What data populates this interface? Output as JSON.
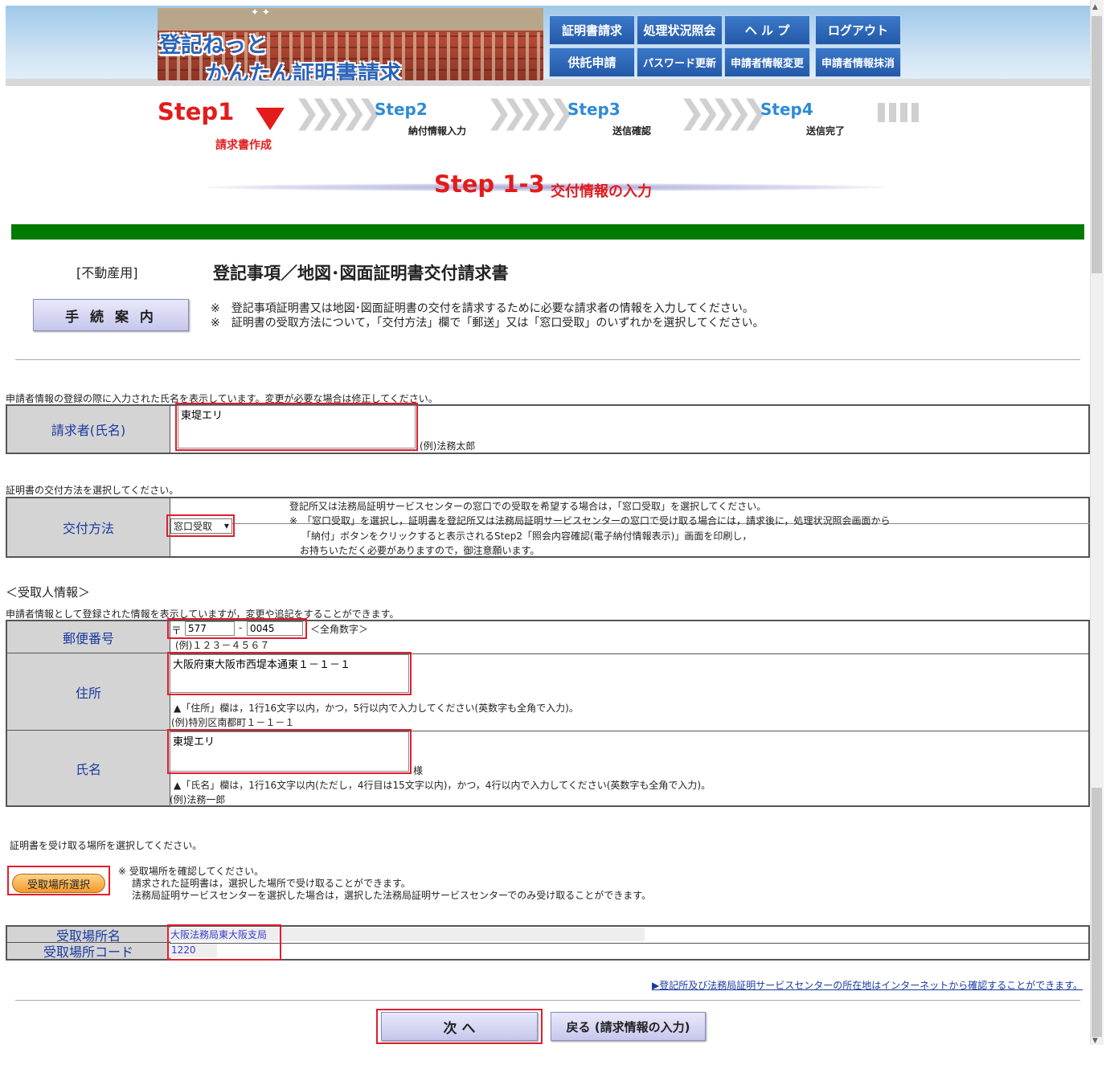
{
  "header": {
    "logo_line1": "登記ねっと",
    "logo_line2": "かんたん証明書請求",
    "nav_top": [
      "証明書請求",
      "処理状況照会",
      "ヘ ル プ",
      "ログアウト"
    ],
    "nav_bottom": [
      "供託申請",
      "パスワード更新",
      "申請者情報変更",
      "申請者情報抹消"
    ]
  },
  "steps": {
    "step1": "Step1",
    "step1_sub": "請求書作成",
    "step2": "Step2",
    "step2_sub": "納付情報入力",
    "step3": "Step3",
    "step3_sub": "送信確認",
    "step4": "Step4",
    "step4_sub": "送信完了",
    "current": "Step 1-3",
    "current_sub": "交付情報の入力"
  },
  "form_header": {
    "category": "[不動産用]",
    "title": "登記事項／地図･図面証明書交付請求書",
    "guide_button": "手 続 案 内",
    "note1": "※　登記事項証明書又は地図･図面証明書の交付を請求するために必要な請求者の情報を入力してください。",
    "note2": "※　証明書の受取方法について，「交付方法」欄で「郵送」又は「窓口受取」のいずれかを選択してください。"
  },
  "requester": {
    "intro": "申請者情報の登録の際に入力された氏名を表示しています。変更が必要な場合は修正してください。",
    "label": "請求者(氏名)",
    "value": "東堤エリ",
    "example": "(例)法務太郎"
  },
  "delivery": {
    "intro": "証明書の交付方法を選択してください。",
    "label": "交付方法",
    "selected": "窓口受取",
    "note1": "登記所又は法務局証明サービスセンターの窓口での受取を希望する場合は，「窓口受取」を選択してください。",
    "note2": "※　「窓口受取」を選択し，証明書を登記所又は法務局証明サービスセンターの窓口で受け取る場合には，請求後に，処理状況照会画面から",
    "note3": "「納付」ボタンをクリックすると表示されるStep2「照会内容確認(電子納付情報表示)」画面を印刷し，",
    "note4": "お持ちいただく必要がありますので，御注意願います。"
  },
  "recipient": {
    "heading": "＜受取人情報＞",
    "intro": "申請者情報として登録された情報を表示していますが，変更や追記をすることができます。",
    "postal_label": "郵便番号",
    "postal_mark": "〒",
    "postal1": "577",
    "postal_dash": "-",
    "postal2": "0045",
    "postal_hint": "＜全角数字＞",
    "postal_example": "(例)１２３－４５６７",
    "address_label": "住所",
    "address_value": "大阪府東大阪市西堤本通東１－１－１",
    "address_hint": "▲「住所」欄は，1行16文字以内，かつ，5行以内で入力してください(英数字も全角で入力)。",
    "address_example": "(例)特別区南都町１－１－１",
    "name_label": "氏名",
    "name_value": "東堤エリ",
    "name_suffix": "様",
    "name_hint": "▲「氏名」欄は，1行16文字以内(ただし，4行目は15文字以内)，かつ，4行以内で入力してください(英数字も全角で入力)。",
    "name_example": "(例)法務一郎"
  },
  "pickup": {
    "intro": "証明書を受け取る場所を選択してください。",
    "button": "受取場所選択",
    "note1": "※ 受取場所を確認してください。",
    "note2": "請求された証明書は，選択した場所で受け取ることができます。",
    "note3": "法務局証明サービスセンターを選択した場合は，選択した法務局証明サービスセンターでのみ受け取ることができます。",
    "place_label": "受取場所名",
    "place_value": "大阪法務局東大阪支局",
    "code_label": "受取場所コード",
    "code_value": "1220",
    "link": "▶登記所及び法務局証明サービスセンターの所在地はインターネットから確認することができます。"
  },
  "buttons": {
    "next": "次 へ",
    "back": "戻る (請求情報の入力)"
  },
  "colors": {
    "accent_red": "#e31b1b",
    "step_blue": "#2e8bd6",
    "nav_blue": "#2358a8",
    "green_bar": "#007a00",
    "highlight_red": "#e01e2e"
  }
}
